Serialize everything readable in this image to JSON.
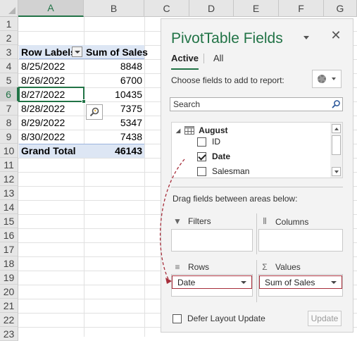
{
  "spreadsheet": {
    "columns": [
      "A",
      "B",
      "C",
      "D",
      "E",
      "F",
      "G"
    ],
    "selected_column": "A",
    "rows": [
      "1",
      "2",
      "3",
      "4",
      "5",
      "6",
      "7",
      "8",
      "9",
      "10",
      "11",
      "12",
      "13",
      "14",
      "15",
      "16",
      "17",
      "18",
      "19",
      "20",
      "21",
      "22",
      "23"
    ],
    "selected_row": "6",
    "pivot": {
      "header": [
        "Row Labels",
        "Sum of Sales"
      ],
      "data": [
        [
          "8/25/2022",
          "8848"
        ],
        [
          "8/26/2022",
          "6700"
        ],
        [
          "8/27/2022",
          "10435"
        ],
        [
          "8/28/2022",
          "7375"
        ],
        [
          "8/29/2022",
          "5347"
        ],
        [
          "8/30/2022",
          "7438"
        ]
      ],
      "total": [
        "Grand Total",
        "46143"
      ]
    }
  },
  "pivot_panel": {
    "title": "PivotTable Fields",
    "tabs": {
      "active": "Active",
      "all": "All"
    },
    "choose_label": "Choose fields to add to report:",
    "search_placeholder": "Search",
    "table_name": "August",
    "fields": [
      {
        "name": "ID",
        "checked": false
      },
      {
        "name": "Date",
        "checked": true
      },
      {
        "name": "Salesman",
        "checked": false
      }
    ],
    "drag_label": "Drag fields between areas below:",
    "areas": {
      "filters": "Filters",
      "columns": "Columns",
      "rows": "Rows",
      "values": "Values"
    },
    "rows_field": "Date",
    "values_field": "Sum of Sales",
    "defer_label": "Defer Layout Update",
    "update_label": "Update"
  },
  "colors": {
    "excel_green": "#217346",
    "pivot_header": "#dde6f4",
    "drag_arrow": "#a72e3b"
  }
}
